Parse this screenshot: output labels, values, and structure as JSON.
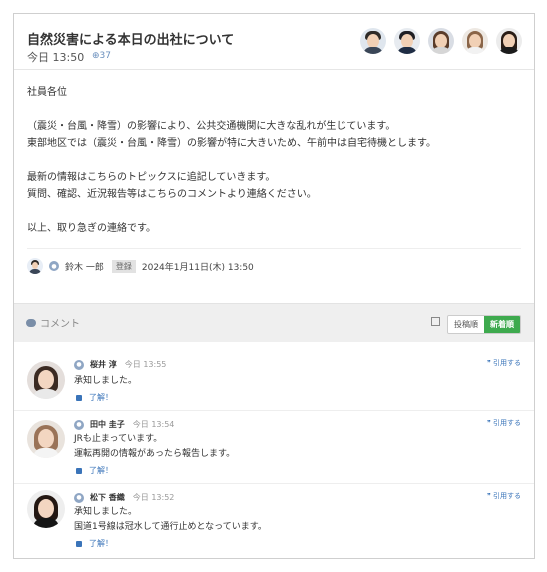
{
  "post": {
    "title": "自然災害による本日の出社について",
    "time": "今日 13:50",
    "views": "⊕37",
    "body": [
      "社員各位",
      "",
      "（震災・台風・降雪）の影響により、公共交通機関に大きな乱れが生じています。",
      "東部地区では（震災・台風・降雪）の影響が特に大きいため、午前中は自宅待機とします。",
      "",
      "最新の情報はこちらのトピックスに追記していきます。",
      "質問、確認、近況報告等はこちらのコメントより連絡ください。",
      "",
      "以上、取り急ぎの連絡です。"
    ],
    "author": {
      "name": "鈴木 一郎",
      "status": "登録",
      "date": "2024年1月11日(木) 13:50"
    }
  },
  "comments_bar": {
    "label": "コメント",
    "sort_old": "投稿順",
    "sort_new": "新着順"
  },
  "comments": [
    {
      "name": "桜井 淳",
      "time": "今日 13:55",
      "lines": [
        "承知しました。"
      ],
      "like": "了解！",
      "quote": "引用する"
    },
    {
      "name": "田中 圭子",
      "time": "今日 13:54",
      "lines": [
        "JRも止まっています。",
        "運転再開の情報があったら報告します。"
      ],
      "like": "了解！",
      "quote": "引用する"
    },
    {
      "name": "松下 香織",
      "time": "今日 13:52",
      "lines": [
        "承知しました。",
        "国道1号線は冠水して通行止めとなっています。"
      ],
      "like": "了解！",
      "quote": "引用する"
    }
  ],
  "colors": {
    "accent": "#3eaa4e",
    "link": "#3a74b9"
  }
}
